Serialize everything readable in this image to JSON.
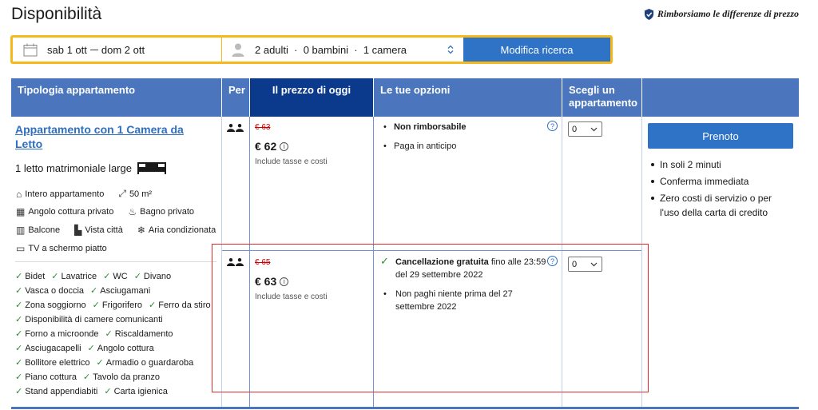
{
  "page": {
    "title": "Disponibilità",
    "refund_note": "Rimborsiamo le differenze di prezzo"
  },
  "search": {
    "checkin": "sab 1 ott",
    "checkout": "dom 2 ott",
    "guests": "2 adulti  ·  0 bambini  ·  1 camera",
    "button": "Modifica ricerca"
  },
  "table": {
    "headers": {
      "type": "Tipologia appartamento",
      "per": "Per",
      "price": "Il prezzo di oggi",
      "options": "Le tue opzioni",
      "choose": "Scegli un appartamento"
    }
  },
  "room": {
    "name": "Appartamento con 1 Camera da Letto",
    "bed": "1 letto matrimoniale large",
    "facilities": {
      "whole": "Intero appartamento",
      "size": "50 m²",
      "kitchen": "Angolo cottura privato",
      "bathroom": "Bagno privato",
      "balcony": "Balcone",
      "city_view": "Vista città",
      "ac": "Aria condizionata",
      "tv": "TV a schermo piatto"
    },
    "amenities": [
      [
        "Bidet",
        "Lavatrice",
        "WC",
        "Divano"
      ],
      [
        "Vasca o doccia",
        "Asciugamani"
      ],
      [
        "Zona soggiorno",
        "Frigorifero",
        "Ferro da stiro"
      ],
      [
        "Disponibilità di camere comunicanti"
      ],
      [
        "Forno a microonde",
        "Riscaldamento"
      ],
      [
        "Asciugacapelli",
        "Angolo cottura"
      ],
      [
        "Bollitore elettrico",
        "Armadio o guardaroba"
      ],
      [
        "Piano cottura",
        "Tavolo da pranzo"
      ],
      [
        "Stand appendiabiti",
        "Carta igienica"
      ]
    ]
  },
  "offers": [
    {
      "old_price": "€ 63",
      "price": "€ 62",
      "tax_note": "Include tasse e costi",
      "option_title": "Non rimborsabile",
      "option_sub": "Paga in anticipo",
      "select_value": "0"
    },
    {
      "old_price": "€ 65",
      "price": "€ 63",
      "tax_note": "Include tasse e costi",
      "option_title": "Cancellazione gratuita",
      "option_title_rest": " fino alle 23:59 del 29 settembre 2022",
      "option_sub": "Non paghi niente prima del 27 settembre 2022",
      "select_value": "0"
    }
  ],
  "booking": {
    "button": "Prenoto",
    "perks": [
      "In soli 2 minuti",
      "Conferma immediata",
      "Zero costi di servizio o per l'uso della carta di credito"
    ]
  },
  "colors": {
    "accent": "#2f73c7",
    "header": "#4b76bd",
    "header_dark": "#0b3a8c",
    "search_border": "#f5b91b",
    "highlight": "#e52b2b",
    "green": "#2e8b2e",
    "strike": "#cc0000"
  }
}
